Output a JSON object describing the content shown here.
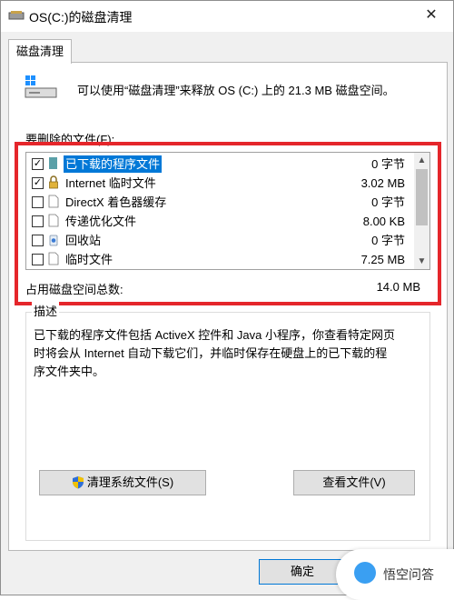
{
  "window": {
    "title": "OS(C:)的磁盘清理",
    "close_glyph": "✕"
  },
  "tab": {
    "label": "磁盘清理"
  },
  "header": {
    "message": "可以使用“磁盘清理”来释放 OS (C:) 上的 21.3 MB 磁盘空间。"
  },
  "files_section": {
    "label": "要删除的文件(F):"
  },
  "files": [
    {
      "name": "已下载的程序文件",
      "size": "0 字节",
      "checked": true,
      "selected": true,
      "icon": "folder-icon"
    },
    {
      "name": "Internet 临时文件",
      "size": "3.02 MB",
      "checked": true,
      "selected": false,
      "icon": "lock-icon"
    },
    {
      "name": "DirectX 着色器缓存",
      "size": "0 字节",
      "checked": false,
      "selected": false,
      "icon": "file-icon"
    },
    {
      "name": "传递优化文件",
      "size": "8.00 KB",
      "checked": false,
      "selected": false,
      "icon": "file-icon"
    },
    {
      "name": "回收站",
      "size": "0 字节",
      "checked": false,
      "selected": false,
      "icon": "recycle-bin-icon"
    },
    {
      "name": "临时文件",
      "size": "7.25 MB",
      "checked": false,
      "selected": false,
      "icon": "file-icon"
    }
  ],
  "total": {
    "label": "占用磁盘空间总数:",
    "value": "14.0 MB"
  },
  "description": {
    "title": "描述",
    "lines": [
      "已下载的程序文件包括 ActiveX 控件和 Java 小程序，你查看特定网页",
      "时将会从 Internet 自动下载它们，并临时保存在硬盘上的已下载的程",
      "序文件夹中。"
    ]
  },
  "buttons": {
    "cleanup": "清理系统文件(S)",
    "view": "查看文件(V)",
    "ok": "确定"
  },
  "watermark": {
    "text": "悟空问答"
  },
  "colors": {
    "selection": "#0078d7",
    "highlight_border": "#e5262b"
  }
}
